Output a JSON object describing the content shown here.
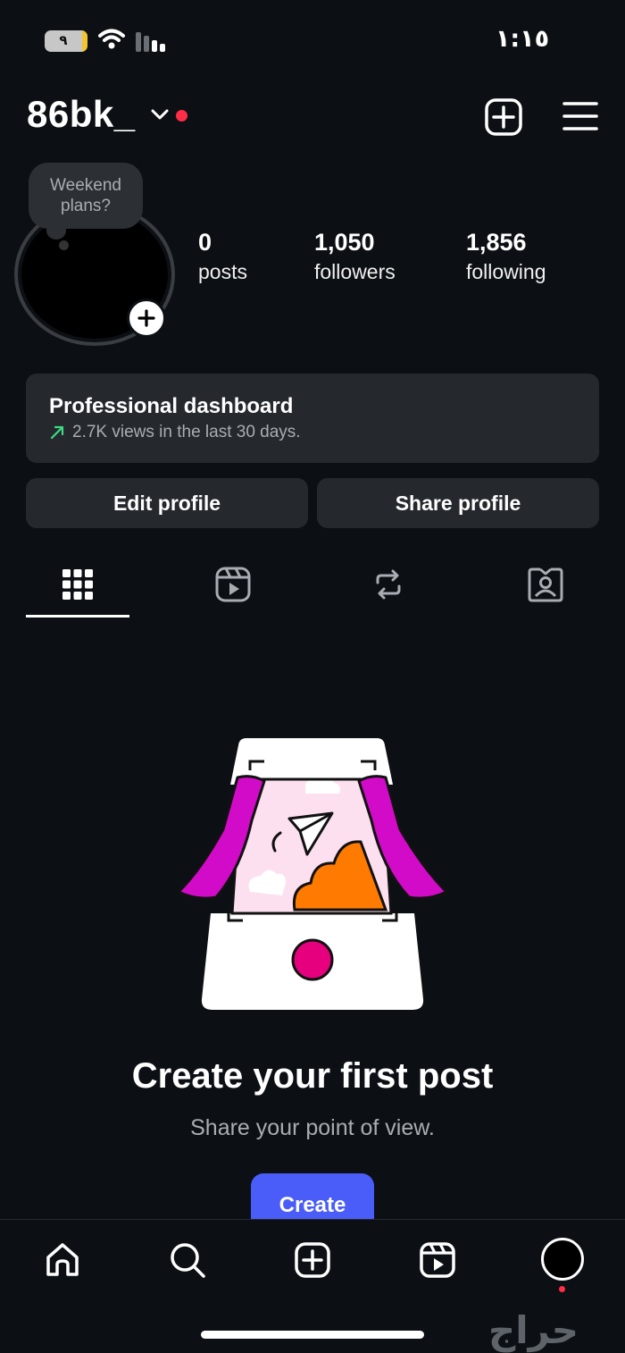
{
  "status_bar": {
    "battery_level": "٩",
    "time": "١:١٥"
  },
  "header": {
    "username": "86bk_",
    "new_post_icon": "plus-square-icon",
    "menu_icon": "hamburger-menu-icon",
    "notification_dot_color": "#ff2d45"
  },
  "profile": {
    "note": [
      "Weekend",
      "plans?"
    ],
    "stats": [
      {
        "value": "0",
        "label": "posts"
      },
      {
        "value": "1,050",
        "label": "followers"
      },
      {
        "value": "1,856",
        "label": "following"
      }
    ]
  },
  "dashboard": {
    "title": "Professional dashboard",
    "subtitle": "2.7K views in the last 30 days.",
    "trend_color": "#3ddc84"
  },
  "actions": {
    "edit": "Edit profile",
    "share": "Share profile"
  },
  "tabs": [
    {
      "icon": "grid-icon",
      "active": true
    },
    {
      "icon": "reels-icon",
      "active": false
    },
    {
      "icon": "reposts-icon",
      "active": false
    },
    {
      "icon": "tagged-icon",
      "active": false
    }
  ],
  "empty_state": {
    "title": "Create your first post",
    "subtitle": "Share your point of view.",
    "button": "Create",
    "accent": "#4a5df9"
  },
  "bottom_nav": [
    {
      "icon": "home-icon"
    },
    {
      "icon": "search-icon"
    },
    {
      "icon": "create-icon"
    },
    {
      "icon": "reels-icon"
    },
    {
      "icon": "profile-avatar"
    }
  ],
  "watermark": "حراج"
}
